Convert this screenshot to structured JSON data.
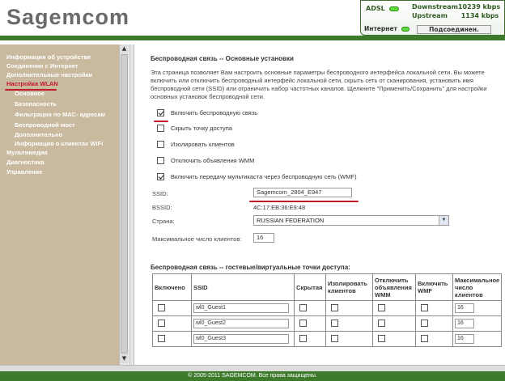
{
  "header": {
    "logo": "Sagemcom",
    "adsl_label": "ADSL",
    "downstream_label": "Downstream",
    "downstream_value": "10239 kbps",
    "upstream_label": "Upstream",
    "upstream_value": "1134 kbps",
    "internet_label": "Интернет",
    "connection_status": "Подсоединен."
  },
  "sidebar": {
    "items": [
      {
        "label": "Информация об устройстве"
      },
      {
        "label": "Соединение с Интернет"
      },
      {
        "label": "Дополнительные настройки"
      },
      {
        "label": "Настройка WLAN"
      },
      {
        "label": "Основное"
      },
      {
        "label": "Безопасность"
      },
      {
        "label": "Фильтрация по МАС- адресам"
      },
      {
        "label": "Беспроводной мост"
      },
      {
        "label": "Дополнительно"
      },
      {
        "label": "Информация о клиентах WiFi"
      },
      {
        "label": "Мультимедиа"
      },
      {
        "label": "Диагностика"
      },
      {
        "label": "Управление"
      }
    ]
  },
  "main": {
    "title": "Беспроводная связь -- Основные установки",
    "intro": "Эта страница позволяет Вам настроить основные параметры беспроводного интерфейса локальной сети. Вы можете включить или отключить беспроводный интерфейс локальной сети, скрыть сеть от сканирования, установить имя беспроводной сети (SSID) или ограничить набор частотных каналов. Щелкните \"Применить/Сохранить\" для настройки основных установок беспроводной сети.",
    "checkboxes": [
      {
        "label": "Включить беспроводную связь",
        "checked": true
      },
      {
        "label": "Скрыть точку доступа",
        "checked": false
      },
      {
        "label": "Изолировать клиентов",
        "checked": false
      },
      {
        "label": "Отключить объявления WMM",
        "checked": false
      },
      {
        "label": "Включить передачу мультикаста через беспроводную сеть (WMF)",
        "checked": true
      }
    ],
    "ssid_label": "SSID:",
    "ssid_value": "Sagemcom_2804_E947",
    "bssid_label": "BSSID:",
    "bssid_value": "4C:17:EB:36:E9:48",
    "country_label": "Страна:",
    "country_value": "RUSSIAN FEDERATION",
    "max_clients_label": "Максимальное число клиентов:",
    "max_clients_value": "16",
    "guest_title": "Беспроводная связь -- гостевые/виртуальные точки доступа:",
    "guest_headers": [
      "Включено",
      "SSID",
      "Скрытая",
      "Изолировать клиентов",
      "Отключить объявления WMM",
      "Включить WMF",
      "Максимальное число клиентов"
    ],
    "guest_rows": [
      {
        "ssid": "wl0_Guest1",
        "max": "16"
      },
      {
        "ssid": "wl0_Guest2",
        "max": "16"
      },
      {
        "ssid": "wl0_Guest3",
        "max": "16"
      }
    ]
  },
  "footer": {
    "text": "© 2005-2011 SAGEMCOM. Все права защищены."
  },
  "colors": {
    "brand_green": "#3d7a2c",
    "sidebar_bg": "#c9b99e",
    "highlight_red": "#c3172b"
  }
}
